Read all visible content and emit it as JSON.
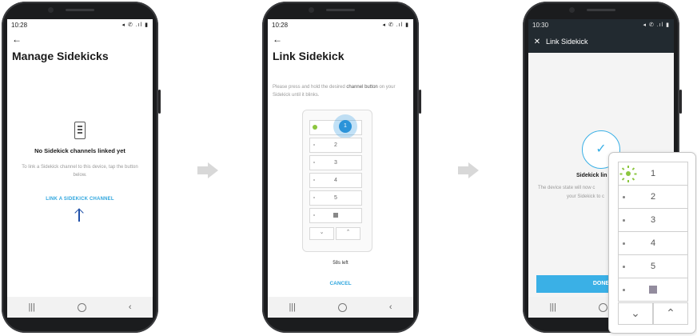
{
  "step1": {
    "status_time": "10:28",
    "status_icons": "◂ ✆ .ıl ▮",
    "title": "Manage Sidekicks",
    "empty_title": "No Sidekick channels linked yet",
    "empty_desc": "To link a Sidekick channel to this device, tap the button below.",
    "link_button": "LINK A SIDEKICK CHANNEL"
  },
  "step2": {
    "status_time": "10:28",
    "status_icons": "◂ ✆ .ıl ▮",
    "title": "Link Sidekick",
    "instr_pre": "Please press and hold the desired ",
    "instr_bold": "channel button",
    "instr_post": " on your Sidekick until it blinks.",
    "channels": [
      "1",
      "2",
      "3",
      "4",
      "5"
    ],
    "seconds_left": "58s left",
    "cancel_button": "CANCEL"
  },
  "step3": {
    "status_time": "10:30",
    "status_icons": "◂ ✆ .ıl ▮",
    "title": "Link Sidekick",
    "success_title": "Sidekick lin",
    "desc_line1": "The device state will now c",
    "desc_line2": "your Sidekick to c",
    "done_button": "DONE"
  },
  "zoom_remote": {
    "channels": [
      "1",
      "2",
      "3",
      "4",
      "5"
    ]
  },
  "icons": {
    "back": "←",
    "close": "✕",
    "check": "✓",
    "chevron_down": "⌄",
    "chevron_up": "⌃",
    "nav_recents": "|||",
    "nav_back": "‹"
  },
  "colors": {
    "accent_blue": "#2fa6de",
    "led_green": "#8cc63f",
    "appbar_dark": "#222a30"
  }
}
